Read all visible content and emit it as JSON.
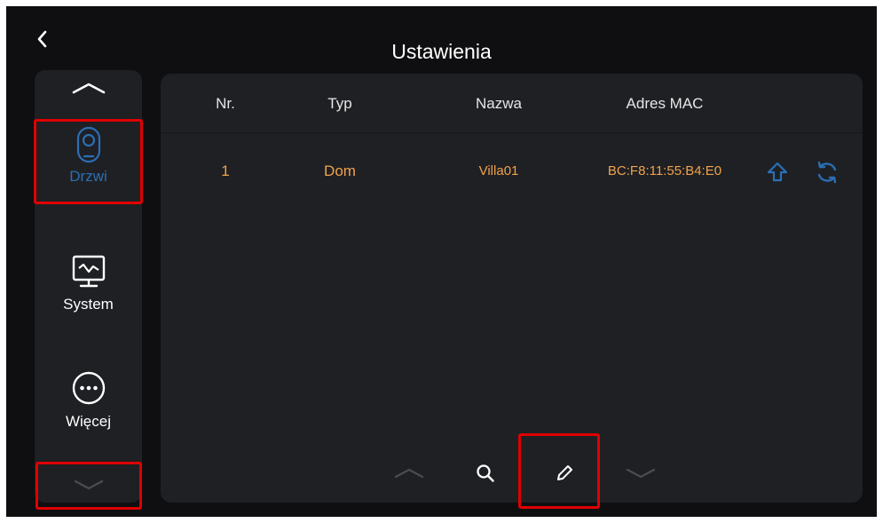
{
  "header": {
    "title": "Ustawienia"
  },
  "sidebar": {
    "items": [
      {
        "label": "Drzwi",
        "icon": "camera-icon",
        "active": true
      },
      {
        "label": "System",
        "icon": "monitor-icon",
        "active": false
      },
      {
        "label": "Więcej",
        "icon": "more-icon",
        "active": false
      }
    ],
    "up_icon": "chevron-up-icon",
    "down_icon": "chevron-down-icon"
  },
  "table": {
    "columns": [
      "Nr.",
      "Typ",
      "Nazwa",
      "Adres MAC"
    ],
    "rows": [
      {
        "nr": "1",
        "typ": "Dom",
        "nazwa": "Villa01",
        "mac": "BC:F8:11:55:B4:E0"
      }
    ]
  },
  "colors": {
    "accent_blue": "#2b6fb5",
    "value_orange": "#f0a24a",
    "highlight_red": "#e00000",
    "panel_bg": "#1f2024",
    "screen_bg": "#0f0f11"
  }
}
